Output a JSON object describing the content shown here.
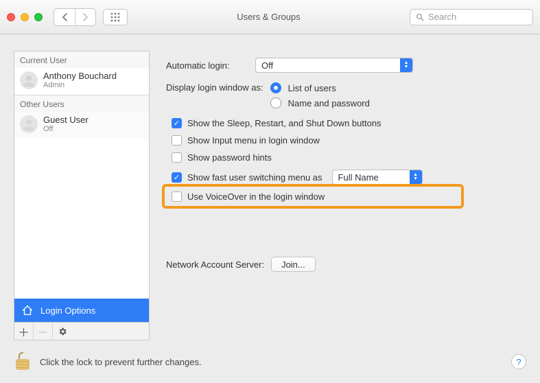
{
  "toolbar": {
    "title": "Users & Groups",
    "search_placeholder": "Search"
  },
  "sidebar": {
    "current_header": "Current User",
    "other_header": "Other Users",
    "current_user": {
      "name": "Anthony Bouchard",
      "role": "Admin"
    },
    "other_user": {
      "name": "Guest User",
      "role": "Off"
    },
    "login_options": "Login Options"
  },
  "settings": {
    "automatic_login_label": "Automatic login:",
    "automatic_login_value": "Off",
    "display_login_label": "Display login window as:",
    "radio_list": "List of users",
    "radio_namepwd": "Name and password",
    "cb_sleep": "Show the Sleep, Restart, and Shut Down buttons",
    "cb_input": "Show Input menu in login window",
    "cb_hints": "Show password hints",
    "cb_fastswitch": "Show fast user switching menu as",
    "fastswitch_value": "Full Name",
    "cb_voiceover": "Use VoiceOver in the login window",
    "nas_label": "Network Account Server:",
    "join_label": "Join..."
  },
  "footer": {
    "lock_text": "Click the lock to prevent further changes."
  }
}
